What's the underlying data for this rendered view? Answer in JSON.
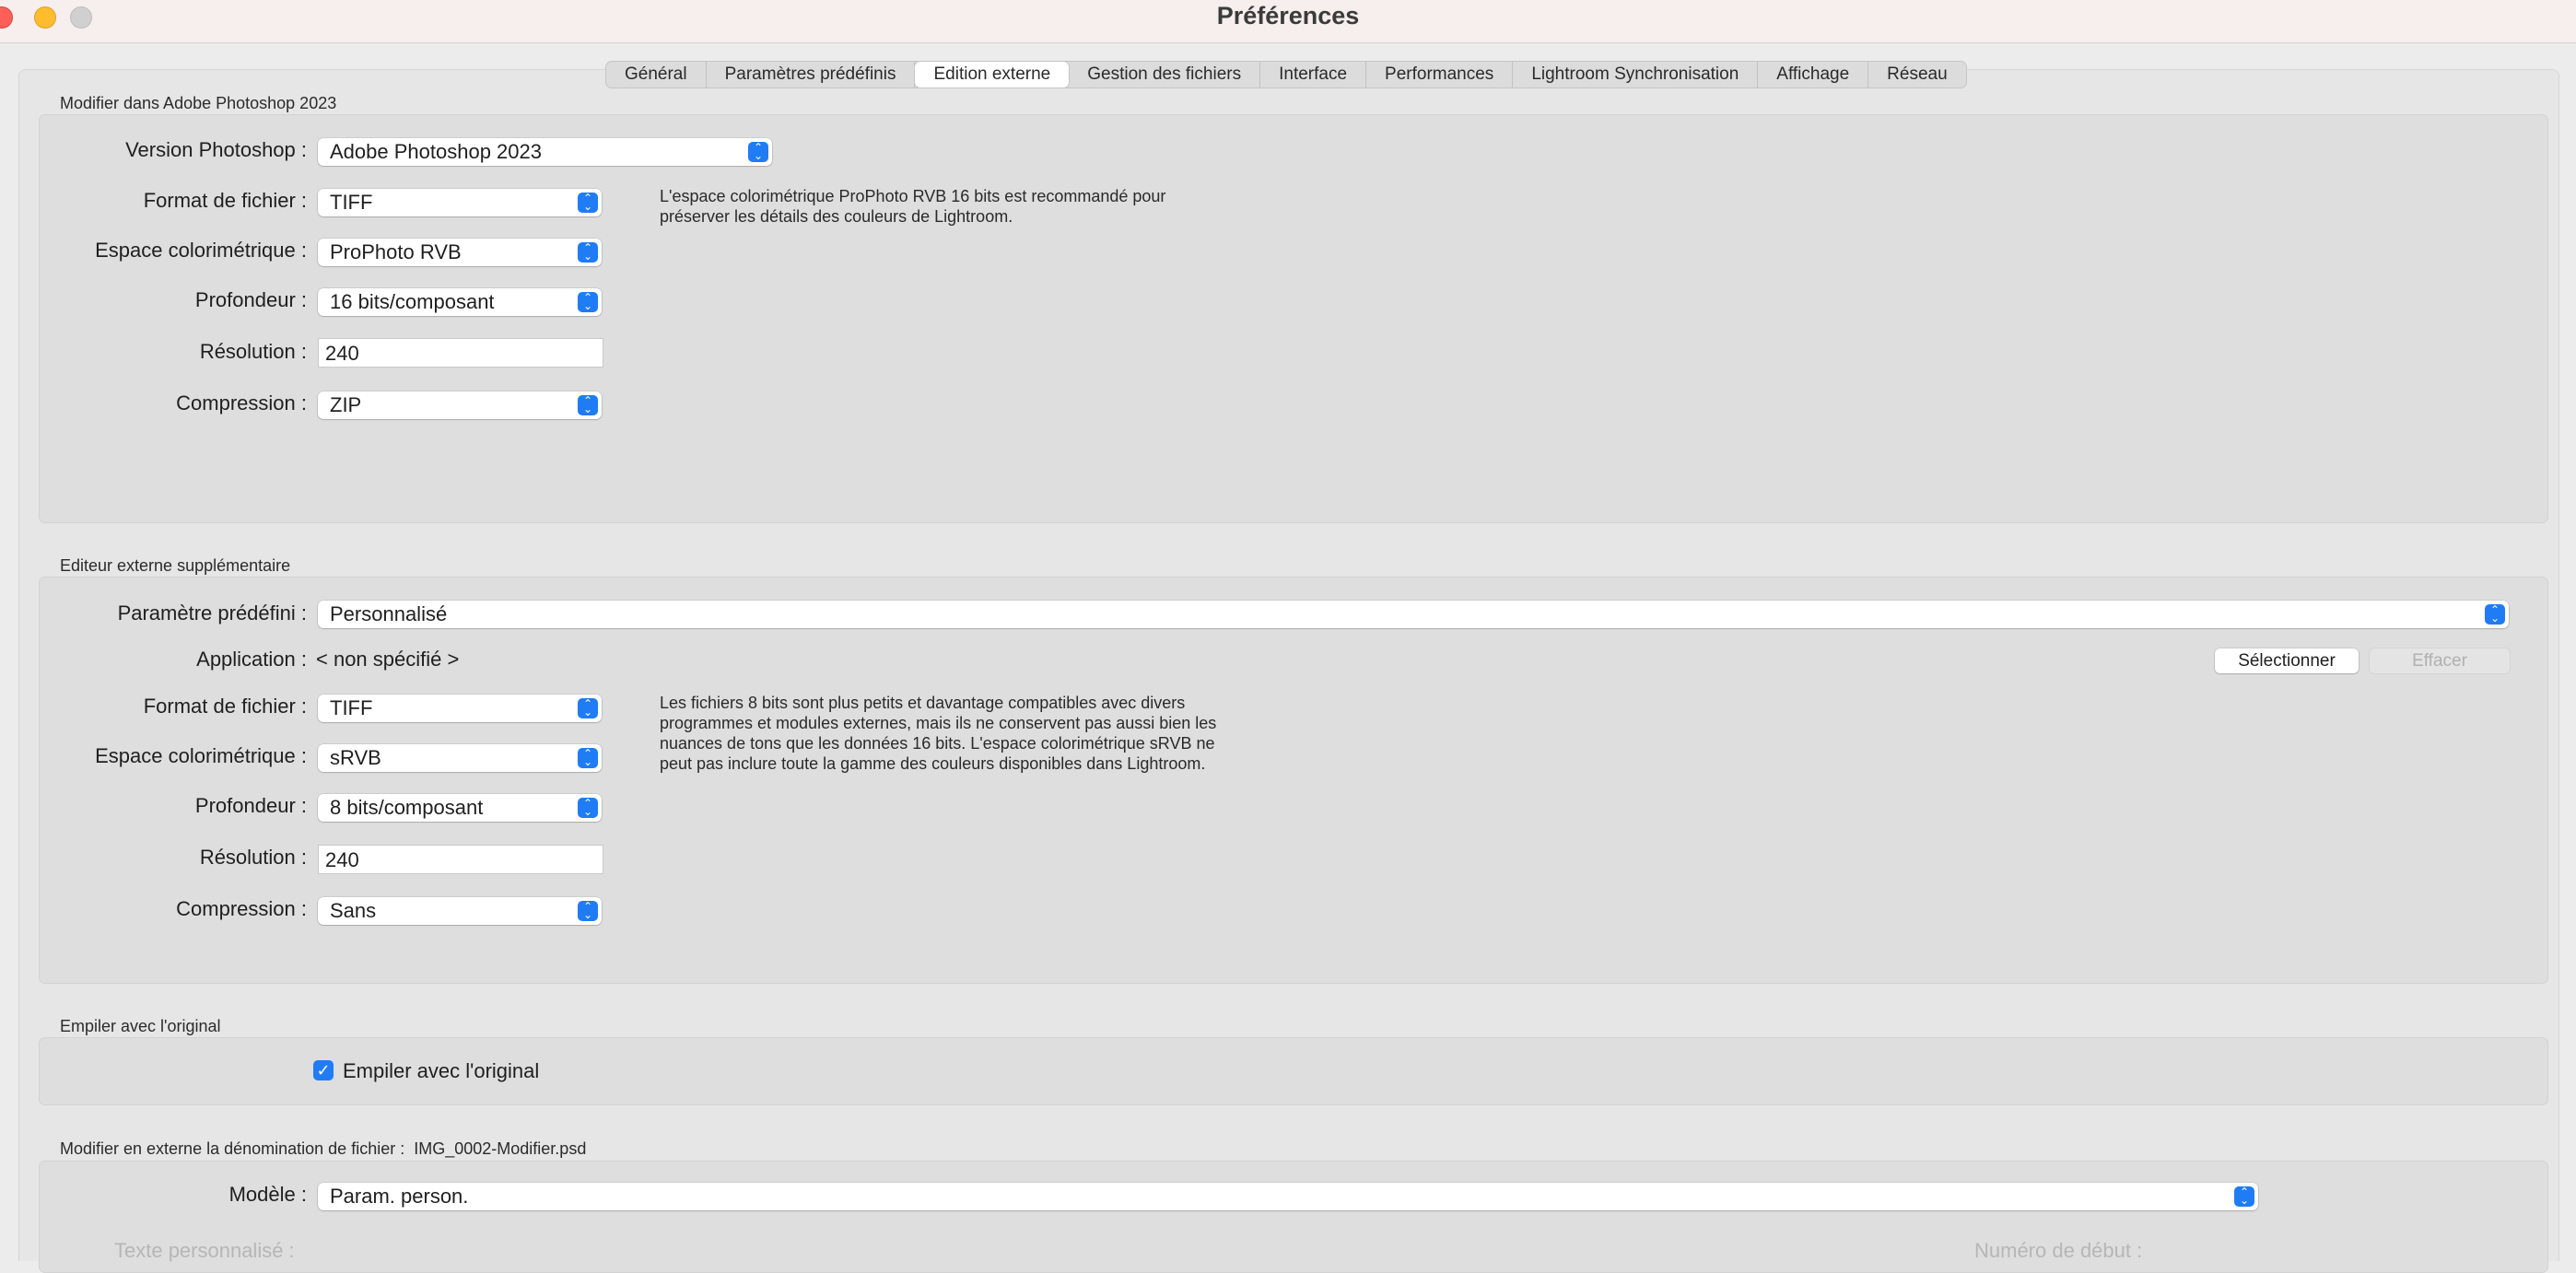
{
  "window": {
    "title": "Préférences",
    "traffic_lights": [
      "close",
      "minimize",
      "zoom"
    ]
  },
  "tabs": [
    {
      "label": "Général",
      "active": false
    },
    {
      "label": "Paramètres prédéfinis",
      "active": false
    },
    {
      "label": "Edition externe",
      "active": true
    },
    {
      "label": "Gestion des fichiers",
      "active": false
    },
    {
      "label": "Interface",
      "active": false
    },
    {
      "label": "Performances",
      "active": false
    },
    {
      "label": "Lightroom Synchronisation",
      "active": false
    },
    {
      "label": "Affichage",
      "active": false
    },
    {
      "label": "Réseau",
      "active": false
    }
  ],
  "photoshop": {
    "title": "Modifier dans Adobe Photoshop 2023",
    "version_label": "Version Photoshop :",
    "version_value": "Adobe Photoshop 2023",
    "format_label": "Format de fichier :",
    "format_value": "TIFF",
    "colorspace_label": "Espace colorimétrique :",
    "colorspace_value": "ProPhoto RVB",
    "depth_label": "Profondeur :",
    "depth_value": "16 bits/composant",
    "resolution_label": "Résolution :",
    "resolution_value": "240",
    "compression_label": "Compression :",
    "compression_value": "ZIP",
    "note": "L'espace colorimétrique ProPhoto RVB 16 bits est recommandé pour préserver les détails des couleurs de Lightroom."
  },
  "external": {
    "title": "Editeur externe supplémentaire",
    "preset_label": "Paramètre prédéfini :",
    "preset_value": "Personnalisé",
    "application_label": "Application :",
    "application_value": "< non spécifié >",
    "select_button": "Sélectionner",
    "clear_button": "Effacer",
    "format_label": "Format de fichier :",
    "format_value": "TIFF",
    "colorspace_label": "Espace colorimétrique :",
    "colorspace_value": "sRVB",
    "depth_label": "Profondeur :",
    "depth_value": "8 bits/composant",
    "resolution_label": "Résolution :",
    "resolution_value": "240",
    "compression_label": "Compression :",
    "compression_value": "Sans",
    "note": "Les fichiers 8 bits sont plus petits et davantage compatibles avec divers programmes et modules externes, mais ils ne conservent pas aussi bien les nuances de tons que les données 16 bits. L'espace colorimétrique sRVB ne peut pas inclure toute la gamme des couleurs disponibles dans Lightroom."
  },
  "stack": {
    "title": "Empiler avec l'original",
    "checkbox_label": "Empiler avec l'original",
    "checked": true
  },
  "naming": {
    "title": "Modifier en externe la dénomination de fichier :",
    "example": "IMG_0002-Modifier.psd",
    "template_label": "Modèle :",
    "template_value": "Param. person.",
    "custom_text_label": "Texte personnalisé :",
    "start_number_label": "Numéro de début :"
  },
  "colors": {
    "accent": "#1f7cf5",
    "titlebar": "#f7eeee",
    "panel": "#dedede",
    "close": "#fe5f57",
    "minimize": "#febc2e"
  }
}
